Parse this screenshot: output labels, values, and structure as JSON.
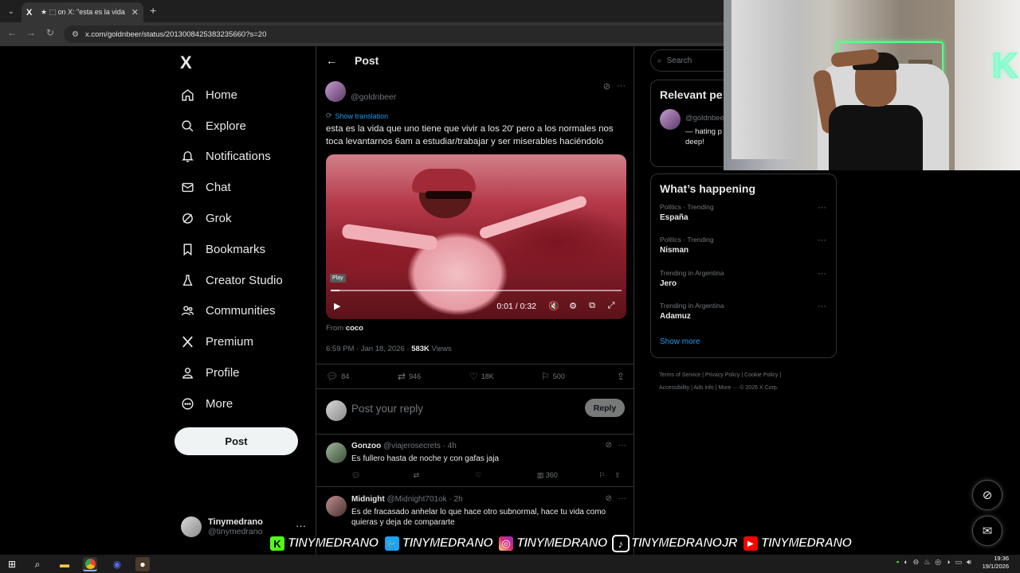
{
  "browser": {
    "tab_title": "★ ⬚ on X: \"esta es la vida que uno",
    "tab_favicon": "X",
    "url": "x.com/goldnbeer/status/2013008425383235660?s=20"
  },
  "nav": {
    "logo": "X",
    "items": [
      {
        "label": "Home",
        "icon": "home-icon"
      },
      {
        "label": "Explore",
        "icon": "search-icon"
      },
      {
        "label": "Notifications",
        "icon": "bell-icon"
      },
      {
        "label": "Chat",
        "icon": "mail-icon"
      },
      {
        "label": "Grok",
        "icon": "grok-icon"
      },
      {
        "label": "Bookmarks",
        "icon": "bookmark-icon"
      },
      {
        "label": "Creator Studio",
        "icon": "flask-icon"
      },
      {
        "label": "Communities",
        "icon": "people-icon"
      },
      {
        "label": "Premium",
        "icon": "x-icon"
      },
      {
        "label": "Profile",
        "icon": "person-icon"
      },
      {
        "label": "More",
        "icon": "more-icon"
      }
    ],
    "post_button": "Post",
    "account": {
      "name": "Tinymedrano",
      "handle": "@tinymedrano",
      "menu": "···"
    }
  },
  "main": {
    "title": "Post",
    "author_handle": "@goldnbeer",
    "show_translation": "Show translation",
    "text": "esta es la vida que uno tiene que vivir a los 20' pero a los normales nos toca levantarnos 6am a estudiar/trabajar y ser miserables haciéndolo",
    "video": {
      "tooltip": "Play",
      "time": "0:01 / 0:32",
      "progress": 0.03
    },
    "from_prefix": "From",
    "from_name": "coco",
    "timestamp": "6:59 PM · Jan 18, 2026 · ",
    "views_count": "583K",
    "views_label": " Views",
    "stats": {
      "replies": "84",
      "reposts": "946",
      "likes": "18K",
      "bookmarks": "500"
    },
    "reply_placeholder": "Post your reply",
    "reply_button": "Reply",
    "replies": [
      {
        "name": "Gonzoo",
        "handle": "@viajerosecrets · 4h",
        "text": "Es fullero hasta de noche y con gafas jaja",
        "views": "360"
      },
      {
        "name": "Midnight",
        "handle": "@Midnight701ok · 2h",
        "text": "Es de fracasado anhelar lo que hace otro subnormal, hace tu vida como quieras y deja de compararte"
      }
    ]
  },
  "sidebar": {
    "search_placeholder": "Search",
    "relevant_title": "Relevant pe",
    "relevant_handle": "@goldnbee",
    "relevant_bio": "— hating p deep!",
    "happening_title": "What’s happening",
    "trends": [
      {
        "context": "Politics · Trending",
        "name": "España"
      },
      {
        "context": "Politics · Trending",
        "name": "Nisman"
      },
      {
        "context": "Trending in Argentina",
        "name": "Jero"
      },
      {
        "context": "Trending in Argentina",
        "name": "Adamuz"
      }
    ],
    "show_more": "Show more",
    "footer": [
      "Terms of Service",
      "Privacy Policy",
      "Cookie Policy",
      "Accessibility",
      "Ads info",
      "More ···",
      "© 2026 X Corp."
    ]
  },
  "banner": [
    {
      "platform": "kick",
      "icon_letter": "K",
      "color": "#53fc18",
      "text": "TINYMEDRANO"
    },
    {
      "platform": "twitter",
      "icon_letter": "🐦",
      "color": "#1da1f2",
      "text": "TINYMEDRANO"
    },
    {
      "platform": "instagram",
      "icon_letter": "◎",
      "color": "#d62976",
      "text": "TINYMEDRANO"
    },
    {
      "platform": "tiktok",
      "icon_letter": "♪",
      "color": "#000000",
      "text": "TINYMEDRANOJR"
    },
    {
      "platform": "youtube",
      "icon_letter": "▶",
      "color": "#ff0000",
      "text": "TINYMEDRANO"
    }
  ],
  "taskbar": {
    "time": "19:36",
    "date": "19/1/2026"
  }
}
